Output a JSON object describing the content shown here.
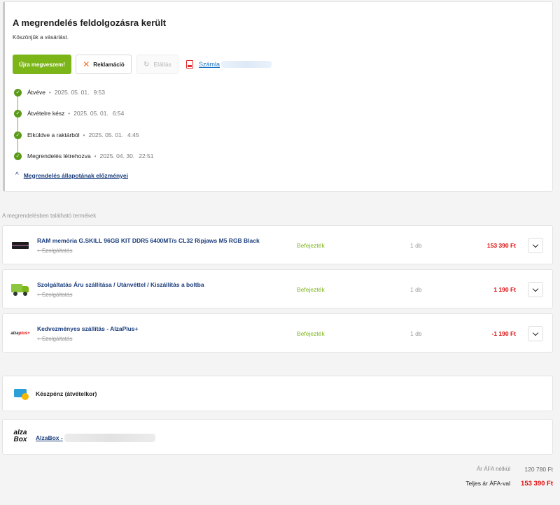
{
  "status": {
    "title": "A megrendelés feldolgozásra került",
    "subtitle": "Köszönjük a vásárlást."
  },
  "actions": {
    "rebuy_label": "Újra megveszem!",
    "complaint_label": "Reklamáció",
    "withdraw_label": "Elállás",
    "invoice_label": "Számla"
  },
  "timeline": [
    {
      "label": "Átvéve",
      "date": "2025. 05. 01.",
      "time": "9:53"
    },
    {
      "label": "Átvételre kész",
      "date": "2025. 05. 01.",
      "time": "6:54"
    },
    {
      "label": "Elküldve a raktárból",
      "date": "2025. 05. 01.",
      "time": "4:45"
    },
    {
      "label": "Megrendelés létrehozva",
      "date": "2025. 04. 30.",
      "time": "22:51"
    }
  ],
  "history_link": "Megrendelés állapotának előzményei",
  "products_caption": "A megrendelésben található termékek",
  "products": [
    {
      "name": "RAM memória G.SKILL 96GB KIT DDR5 6400MT/s CL32 Ripjaws M5 RGB Black",
      "sub": "+ Szolgáltatás",
      "status": "Befejezték",
      "qty": "1 db",
      "price": "153 390 Ft",
      "icon": "ram-module-icon"
    },
    {
      "name": "Szolgáltatás Áru szállítása / Utánvéttel / Kiszállítás a boltba",
      "sub": "+ Szolgáltatás",
      "status": "Befejezték",
      "qty": "1 db",
      "price": "1 190 Ft",
      "icon": "delivery-truck-icon"
    },
    {
      "name": "Kedvezményes szállítás - AlzaPlus+",
      "sub": "+ Szolgáltatás",
      "status": "Befejezték",
      "qty": "1 db",
      "price": "-1 190 Ft",
      "icon": "alzaplus-logo"
    }
  ],
  "alzaplus_logo": {
    "text": "alza",
    "accent": "plus+"
  },
  "payment": {
    "label": "Készpénz (átvételkor)"
  },
  "pickup": {
    "logo_top": "alza",
    "logo_bottom": "Box",
    "label": "AlzaBox -"
  },
  "totals": {
    "net_label": "Ár ÁFA nélkül",
    "net_value": "120 780 Ft",
    "gross_label": "Teljes ár ÁFA-val",
    "gross_value": "153 390 Ft"
  },
  "colors": {
    "accent_green": "#7cb518",
    "price_red": "#e30b0b",
    "link_blue": "#1a3d7c"
  }
}
